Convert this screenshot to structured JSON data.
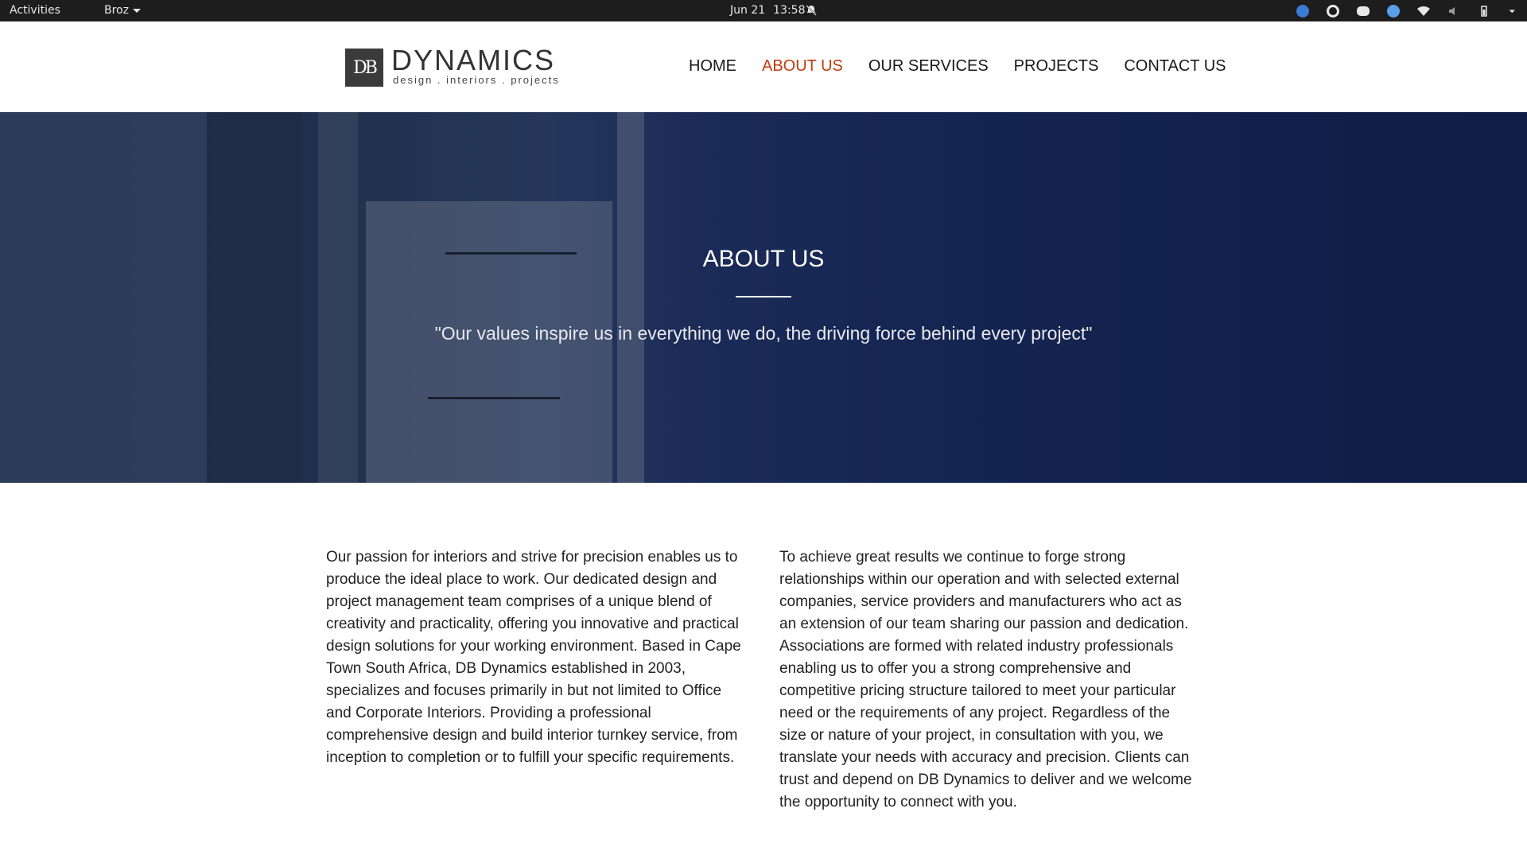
{
  "system_bar": {
    "activities": "Activities",
    "app_menu": "Broz",
    "date": "Jun 21",
    "time": "13:58"
  },
  "brand": {
    "logo_mark": "DB",
    "name": "DYNAMICS",
    "tagline": "design . interiors . projects"
  },
  "nav": {
    "items": [
      "HOME",
      "ABOUT US",
      "OUR SERVICES",
      "PROJECTS",
      "CONTACT US"
    ],
    "active": "ABOUT US",
    "active_color": "#c13b0c"
  },
  "hero": {
    "title": "ABOUT US",
    "quote": "\"Our values inspire us in everything we do, the driving force behind every project\""
  },
  "content": {
    "left_paragraph": "Our passion for interiors and strive for precision enables us to produce the ideal place to work. Our dedicated design and project management team comprises of a unique blend of creativity and practicality, offering you innovative and practical design solutions for your working environment. Based in Cape Town South Africa, DB Dynamics established in 2003, specializes and focuses primarily in but not limited to Office and Corporate Interiors. Providing a professional comprehensive design and build interior turnkey service, from inception to completion or to fulfill your specific requirements.",
    "right_paragraph": "To achieve great results we continue to forge strong relationships within our operation and with selected external companies, service providers and manufacturers who act as an extension of our team sharing our passion and dedication. Associations are formed with related industry professionals enabling us to offer you a strong comprehensive and competitive pricing structure tailored to meet your particular need or the requirements of any project. Regardless of the size or nature of your project, in consultation with you, we translate your needs with accuracy and precision. Clients can trust and depend on DB Dynamics to deliver and we welcome the opportunity to connect with you."
  }
}
